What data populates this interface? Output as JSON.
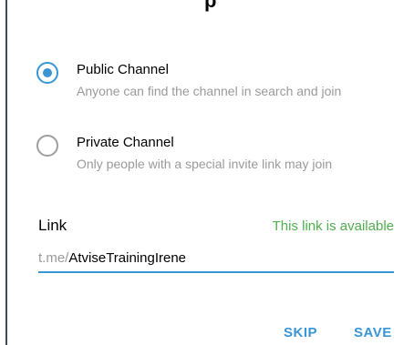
{
  "dialog": {
    "title_fragment": "p"
  },
  "channel_type": {
    "options": [
      {
        "title": "Public Channel",
        "description": "Anyone can find the channel in search and join",
        "selected": true
      },
      {
        "title": "Private Channel",
        "description": "Only people with a special invite link may join",
        "selected": false
      }
    ]
  },
  "link": {
    "label": "Link",
    "status": "This link is available",
    "prefix": "t.me/",
    "value": "AtviseTrainingIrene"
  },
  "actions": {
    "skip_label": "SKIP",
    "save_label": "SAVE"
  },
  "colors": {
    "accent": "#3a95d5",
    "success": "#4fae4e",
    "muted": "#9a9a9a"
  }
}
